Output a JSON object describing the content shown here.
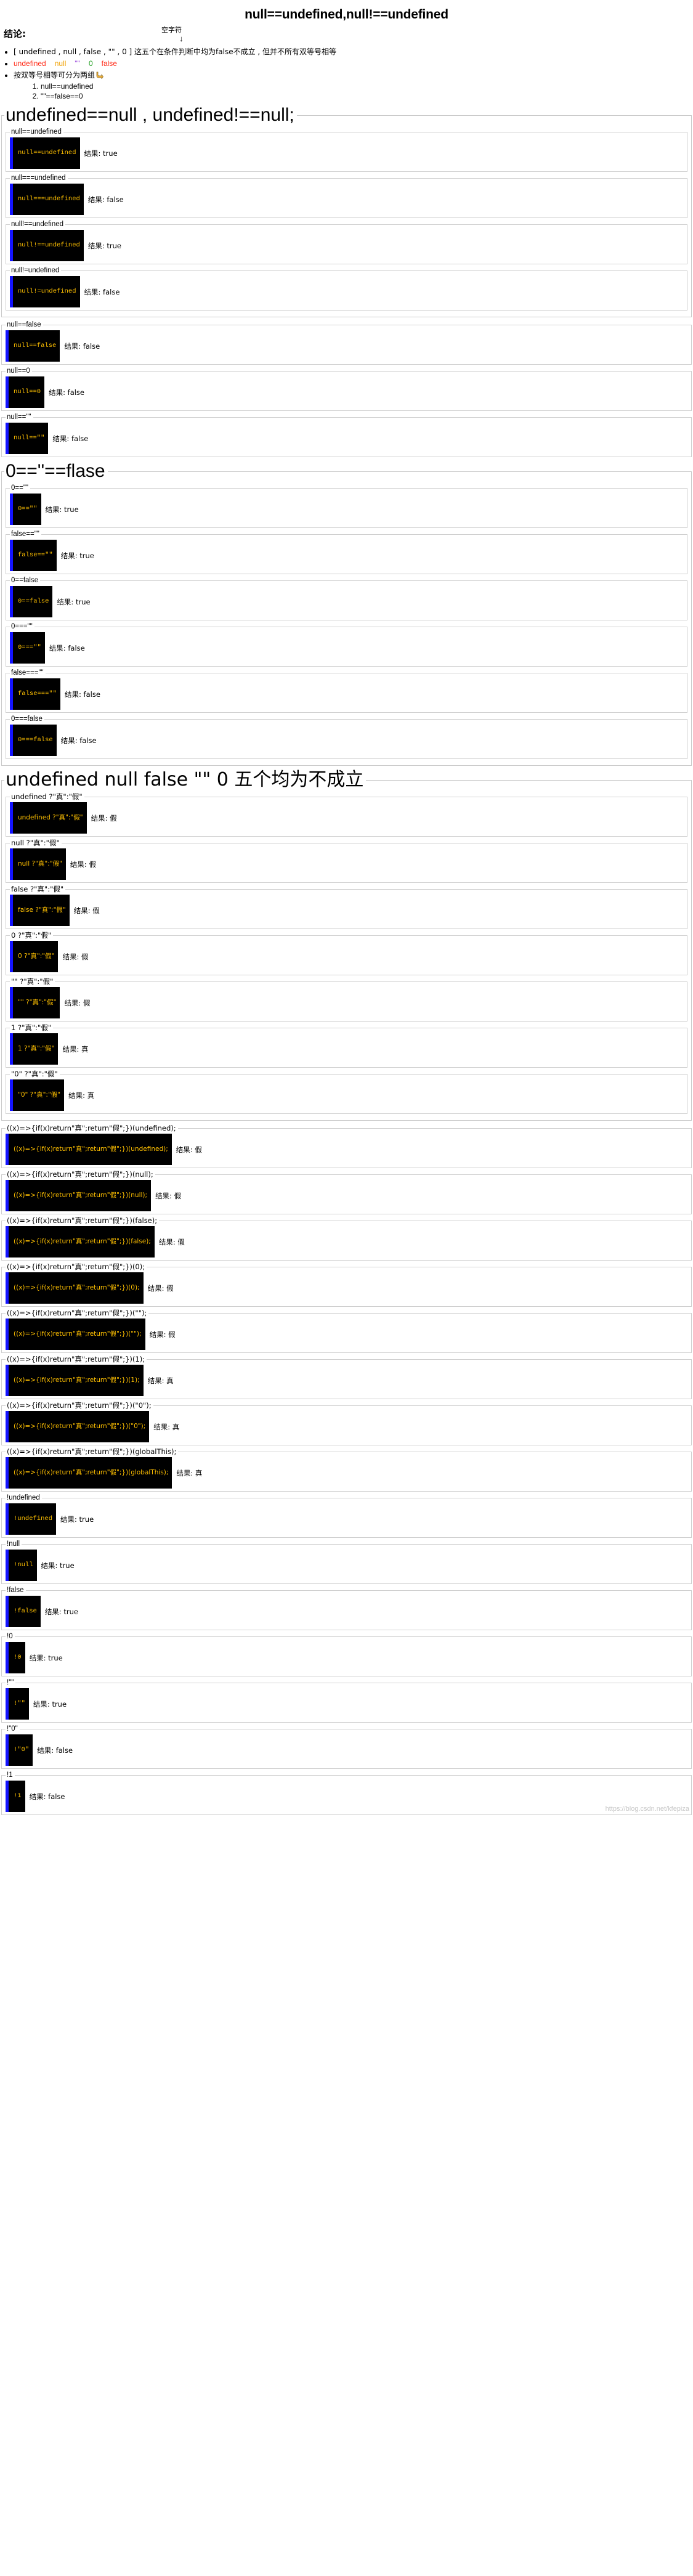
{
  "title": "null==undefined,null!==undefined",
  "conclusion": {
    "label": "结论:",
    "empty_string_note": "空字符",
    "arrow": "↓",
    "bullet1": "[ undefined , null , false , \"\" , 0 ] 这五个在条件判断中均为false不成立 , 但并不所有双等号相等",
    "bullet2_tokens": {
      "undefined": "undefined",
      "null": "null",
      "empty": "\"\"",
      "zero": "0",
      "false": "false"
    },
    "bullet3": "按双等号相等可分为两组",
    "sub_items": [
      "null==undefined",
      "\"\"==false==0"
    ]
  },
  "result_prefix": "结果:",
  "sections": [
    {
      "heading": "undefined==null , undefined!==null;",
      "items": [
        {
          "legend": "null==undefined",
          "code": "null==undefined",
          "result": "true"
        },
        {
          "legend": "null===undefined",
          "code": "null===undefined",
          "result": "false"
        },
        {
          "legend": "null!==undefined",
          "code": "null!==undefined",
          "result": "true"
        },
        {
          "legend": "null!=undefined",
          "code": "null!=undefined",
          "result": "false"
        }
      ]
    }
  ],
  "standalone_group_1": [
    {
      "legend": "null==false",
      "code": "null==false",
      "result": "false"
    },
    {
      "legend": "null==0",
      "code": "null==0",
      "result": "false"
    },
    {
      "legend": "null==\"\"",
      "code": "null==\"\"",
      "result": "false"
    }
  ],
  "section2": {
    "heading": "0==''==flase",
    "items": [
      {
        "legend": "0==\"\"",
        "code": "0==\"\"",
        "result": "true"
      },
      {
        "legend": "false==\"\"",
        "code": "false==\"\"",
        "result": "true"
      },
      {
        "legend": "0==false",
        "code": "0==false",
        "result": "true"
      },
      {
        "legend": "0===\"\"",
        "code": "0===\"\"",
        "result": "false"
      },
      {
        "legend": "false===\"\"",
        "code": "false===\"\"",
        "result": "false"
      },
      {
        "legend": "0===false",
        "code": "0===false",
        "result": "false"
      }
    ]
  },
  "section3": {
    "heading": "undefined   null   false    \"\"    0   五个均为不成立",
    "items": [
      {
        "legend": "undefined ?\"真\":\"假\"",
        "code": "undefined ?\"真\":\"假\"",
        "result": "假"
      },
      {
        "legend": "null ?\"真\":\"假\"",
        "code": "null ?\"真\":\"假\"",
        "result": "假"
      },
      {
        "legend": "false ?\"真\":\"假\"",
        "code": "false ?\"真\":\"假\"",
        "result": "假"
      },
      {
        "legend": "0 ?\"真\":\"假\"",
        "code": "0 ?\"真\":\"假\"",
        "result": "假"
      },
      {
        "legend": "\"\" ?\"真\":\"假\"",
        "code": "\"\" ?\"真\":\"假\"",
        "result": "假"
      },
      {
        "legend": "1 ?\"真\":\"假\"",
        "code": "1 ?\"真\":\"假\"",
        "result": "真"
      },
      {
        "legend": "\"0\" ?\"真\":\"假\"",
        "code": "\"0\" ?\"真\":\"假\"",
        "result": "真"
      }
    ]
  },
  "iife_group": [
    {
      "legend": "((x)=>{if(x)return\"真\";return\"假\";})(undefined);",
      "code": "((x)=>{if(x)return\"真\";return\"假\";})(undefined);",
      "result": "假"
    },
    {
      "legend": "((x)=>{if(x)return\"真\";return\"假\";})(null);",
      "code": "((x)=>{if(x)return\"真\";return\"假\";})(null);",
      "result": "假"
    },
    {
      "legend": "((x)=>{if(x)return\"真\";return\"假\";})(false);",
      "code": "((x)=>{if(x)return\"真\";return\"假\";})(false);",
      "result": "假"
    },
    {
      "legend": "((x)=>{if(x)return\"真\";return\"假\";})(0);",
      "code": "((x)=>{if(x)return\"真\";return\"假\";})(0);",
      "result": "假"
    },
    {
      "legend": "((x)=>{if(x)return\"真\";return\"假\";})(\"\");",
      "code": "((x)=>{if(x)return\"真\";return\"假\";})(\"\");",
      "result": "假"
    },
    {
      "legend": "((x)=>{if(x)return\"真\";return\"假\";})(1);",
      "code": "((x)=>{if(x)return\"真\";return\"假\";})(1);",
      "result": "真"
    },
    {
      "legend": "((x)=>{if(x)return\"真\";return\"假\";})(\"0\");",
      "code": "((x)=>{if(x)return\"真\";return\"假\";})(\"0\");",
      "result": "真"
    },
    {
      "legend": "((x)=>{if(x)return\"真\";return\"假\";})(globalThis);",
      "code": "((x)=>{if(x)return\"真\";return\"假\";})(globalThis);",
      "result": "真"
    }
  ],
  "negation_group": [
    {
      "legend": "!undefined",
      "code": "!undefined",
      "result": "true"
    },
    {
      "legend": "!null",
      "code": "!null",
      "result": "true"
    },
    {
      "legend": "!false",
      "code": "!false",
      "result": "true"
    },
    {
      "legend": "!0",
      "code": "!0",
      "result": "true"
    },
    {
      "legend": "!\"\"",
      "code": "!\"\"",
      "result": "true"
    },
    {
      "legend": "!\"0\"",
      "code": "!\"0\"",
      "result": "false"
    },
    {
      "legend": "!1",
      "code": "!1",
      "result": "false"
    }
  ],
  "watermark": "https://blog.csdn.net/kfepiza"
}
